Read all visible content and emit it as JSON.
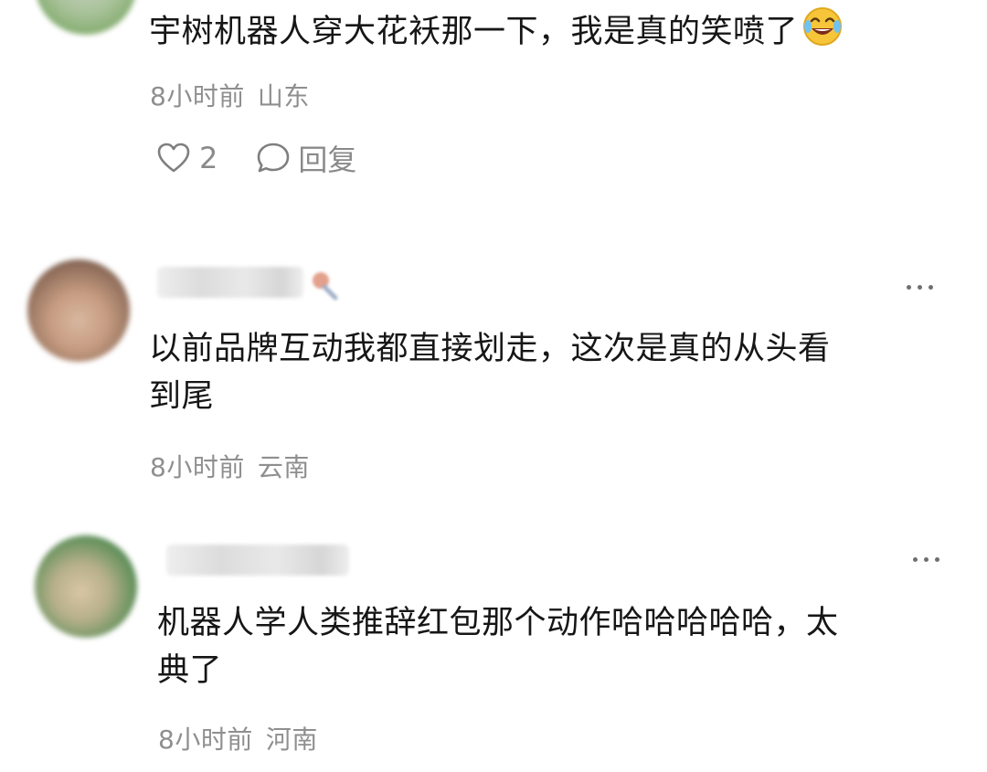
{
  "comments": [
    {
      "text": "宇树机器人穿大花袄那一下，我是真的笑喷了",
      "emoji": "face-with-tears-of-joy",
      "time": "8小时前",
      "location": "山东",
      "likes": "2",
      "reply_label": "回复"
    },
    {
      "text_line1": "以前品牌互动我都直接划走，这次是真的从头看",
      "text_line2": "到尾",
      "time": "8小时前",
      "location": "云南"
    },
    {
      "text_line1": "机器人学人类推辞红包那个动作哈哈哈哈哈，太",
      "text_line2": "典了",
      "time": "8小时前",
      "location": "河南"
    }
  ]
}
